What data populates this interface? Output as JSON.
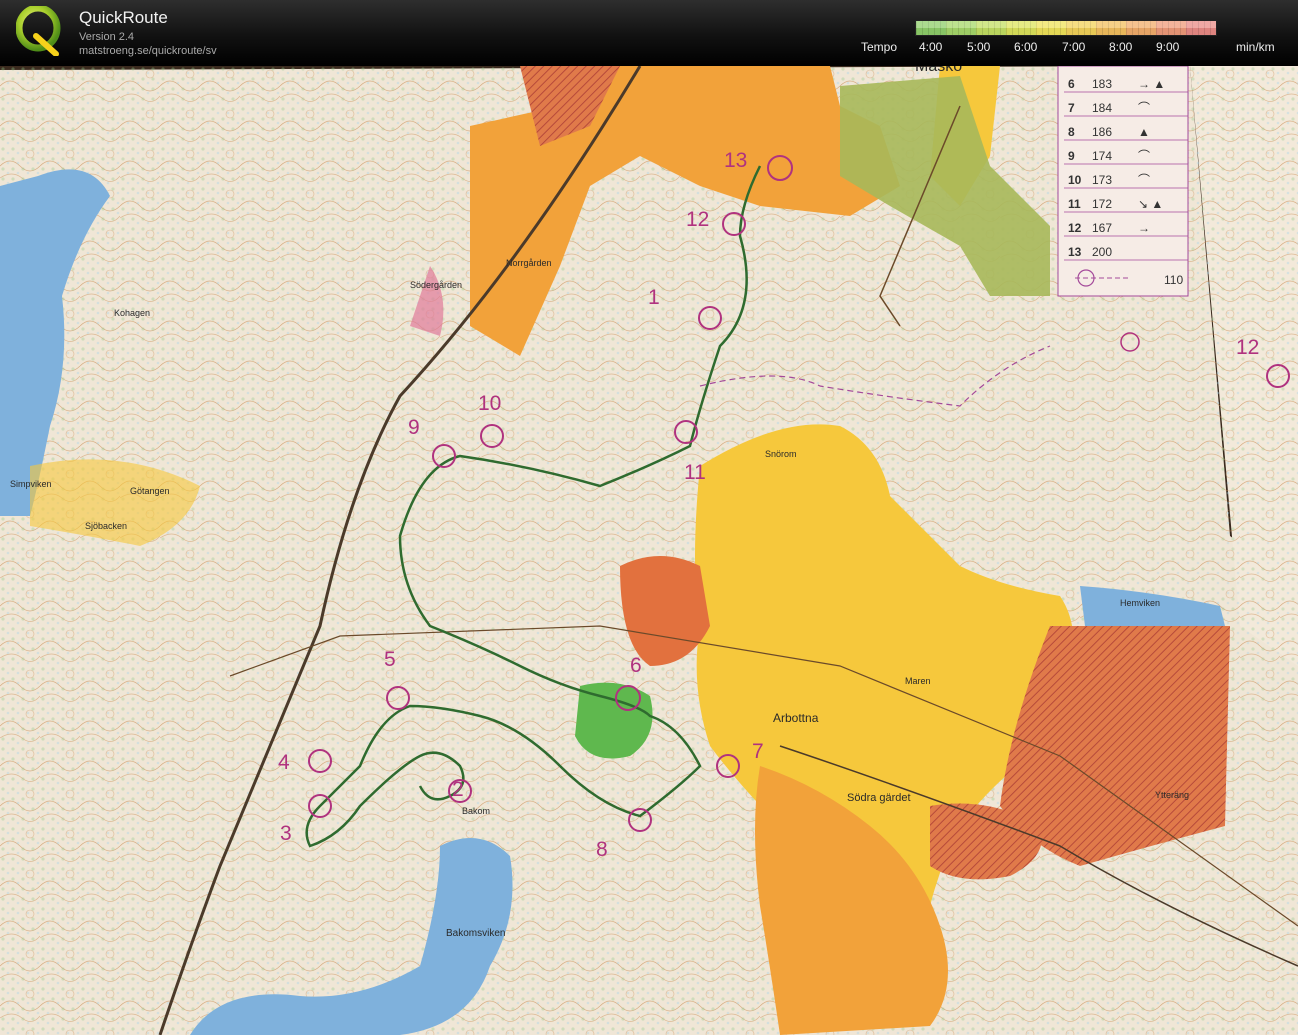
{
  "app": {
    "name": "QuickRoute",
    "version": "Version 2.4",
    "url": "matstroeng.se/quickroute/sv"
  },
  "legend": {
    "title": "Tempo",
    "unit": "min/km",
    "ticks": [
      "4:00",
      "5:00",
      "6:00",
      "7:00",
      "8:00",
      "9:00"
    ],
    "colors": [
      "#8fcf6a",
      "#a7d86a",
      "#c3df63",
      "#dde45c",
      "#f0e35a",
      "#f3d35a",
      "#f3c05f",
      "#f2ad6b",
      "#ef9b7a",
      "#ea8b86"
    ]
  },
  "map": {
    "places": [
      "Simpviken",
      "Götangen",
      "Sjöbacken",
      "Kohagen",
      "Norrgården",
      "Södergården",
      "Snörom",
      "Arbottna",
      "Maren",
      "Hemviken",
      "Södra gärdet",
      "Bakom",
      "Bakomsviken",
      "Ytteräng",
      "Måsko"
    ],
    "controls": [
      "1",
      "2",
      "3",
      "4",
      "5",
      "6",
      "7",
      "8",
      "9",
      "10",
      "11",
      "12",
      "13",
      "12"
    ],
    "control_descriptions": [
      {
        "num": "6",
        "code": "183",
        "symbol": "→ ▲"
      },
      {
        "num": "7",
        "code": "184",
        "symbol": "⌒"
      },
      {
        "num": "8",
        "code": "186",
        "symbol": "▲"
      },
      {
        "num": "9",
        "code": "174",
        "symbol": "⌒"
      },
      {
        "num": "10",
        "code": "173",
        "symbol": "⌒"
      },
      {
        "num": "11",
        "code": "172",
        "symbol": "↘ ▲"
      },
      {
        "num": "12",
        "code": "167",
        "symbol": "→"
      },
      {
        "num": "13",
        "code": "200",
        "symbol": ""
      }
    ],
    "finish_distance": "110"
  },
  "colors": {
    "control": "#b0327f",
    "route": "#2f6b2f",
    "water": "#7fb1dc",
    "open": "#f2a23a",
    "semi_open": "#f6c83c",
    "rough": "#e2713e"
  }
}
